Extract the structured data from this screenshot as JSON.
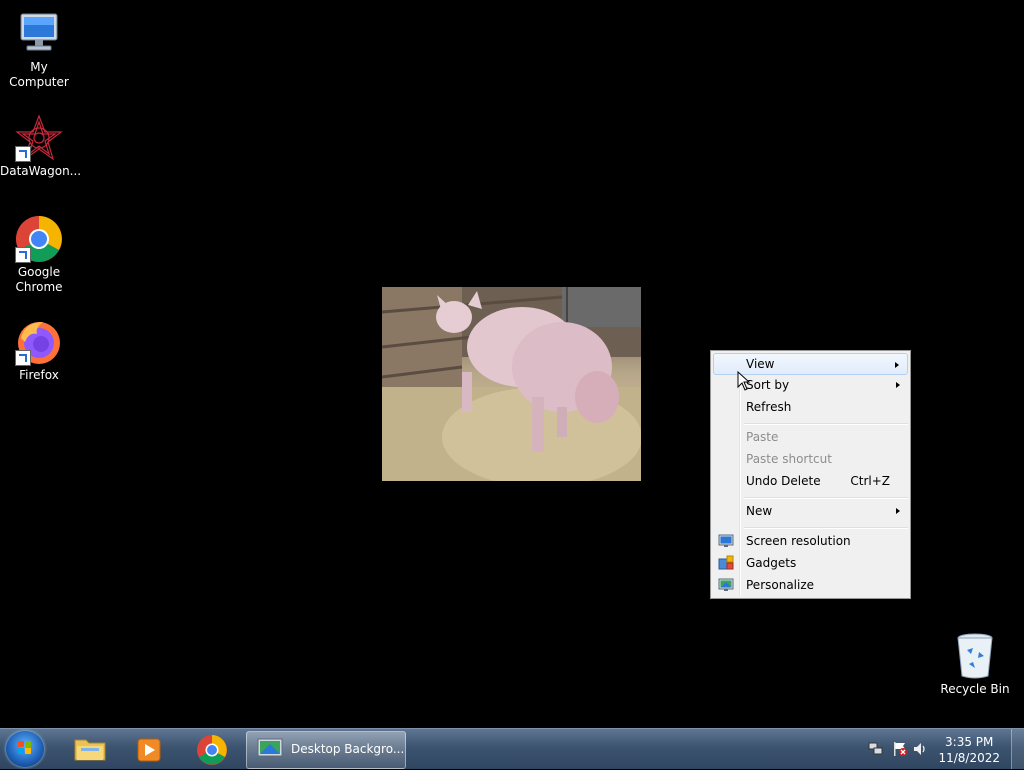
{
  "desktop": {
    "icons": [
      {
        "label": "My Computer"
      },
      {
        "label": "DataWagon..."
      },
      {
        "label": "Google Chrome"
      },
      {
        "label": "Firefox"
      },
      {
        "label": "Recycle Bin"
      }
    ]
  },
  "context_menu": {
    "view": "View",
    "sort_by": "Sort by",
    "refresh": "Refresh",
    "paste": "Paste",
    "paste_shortcut": "Paste shortcut",
    "undo_delete": "Undo Delete",
    "undo_shortcut": "Ctrl+Z",
    "new": "New",
    "screen_resolution": "Screen resolution",
    "gadgets": "Gadgets",
    "personalize": "Personalize"
  },
  "taskbar": {
    "active_window": "Desktop Backgro...",
    "time": "3:35 PM",
    "date": "11/8/2022"
  },
  "colors": {
    "taskbar": "#3d5470",
    "menu_bg": "#f0f0f0",
    "menu_hover": "#e0ecfb"
  }
}
